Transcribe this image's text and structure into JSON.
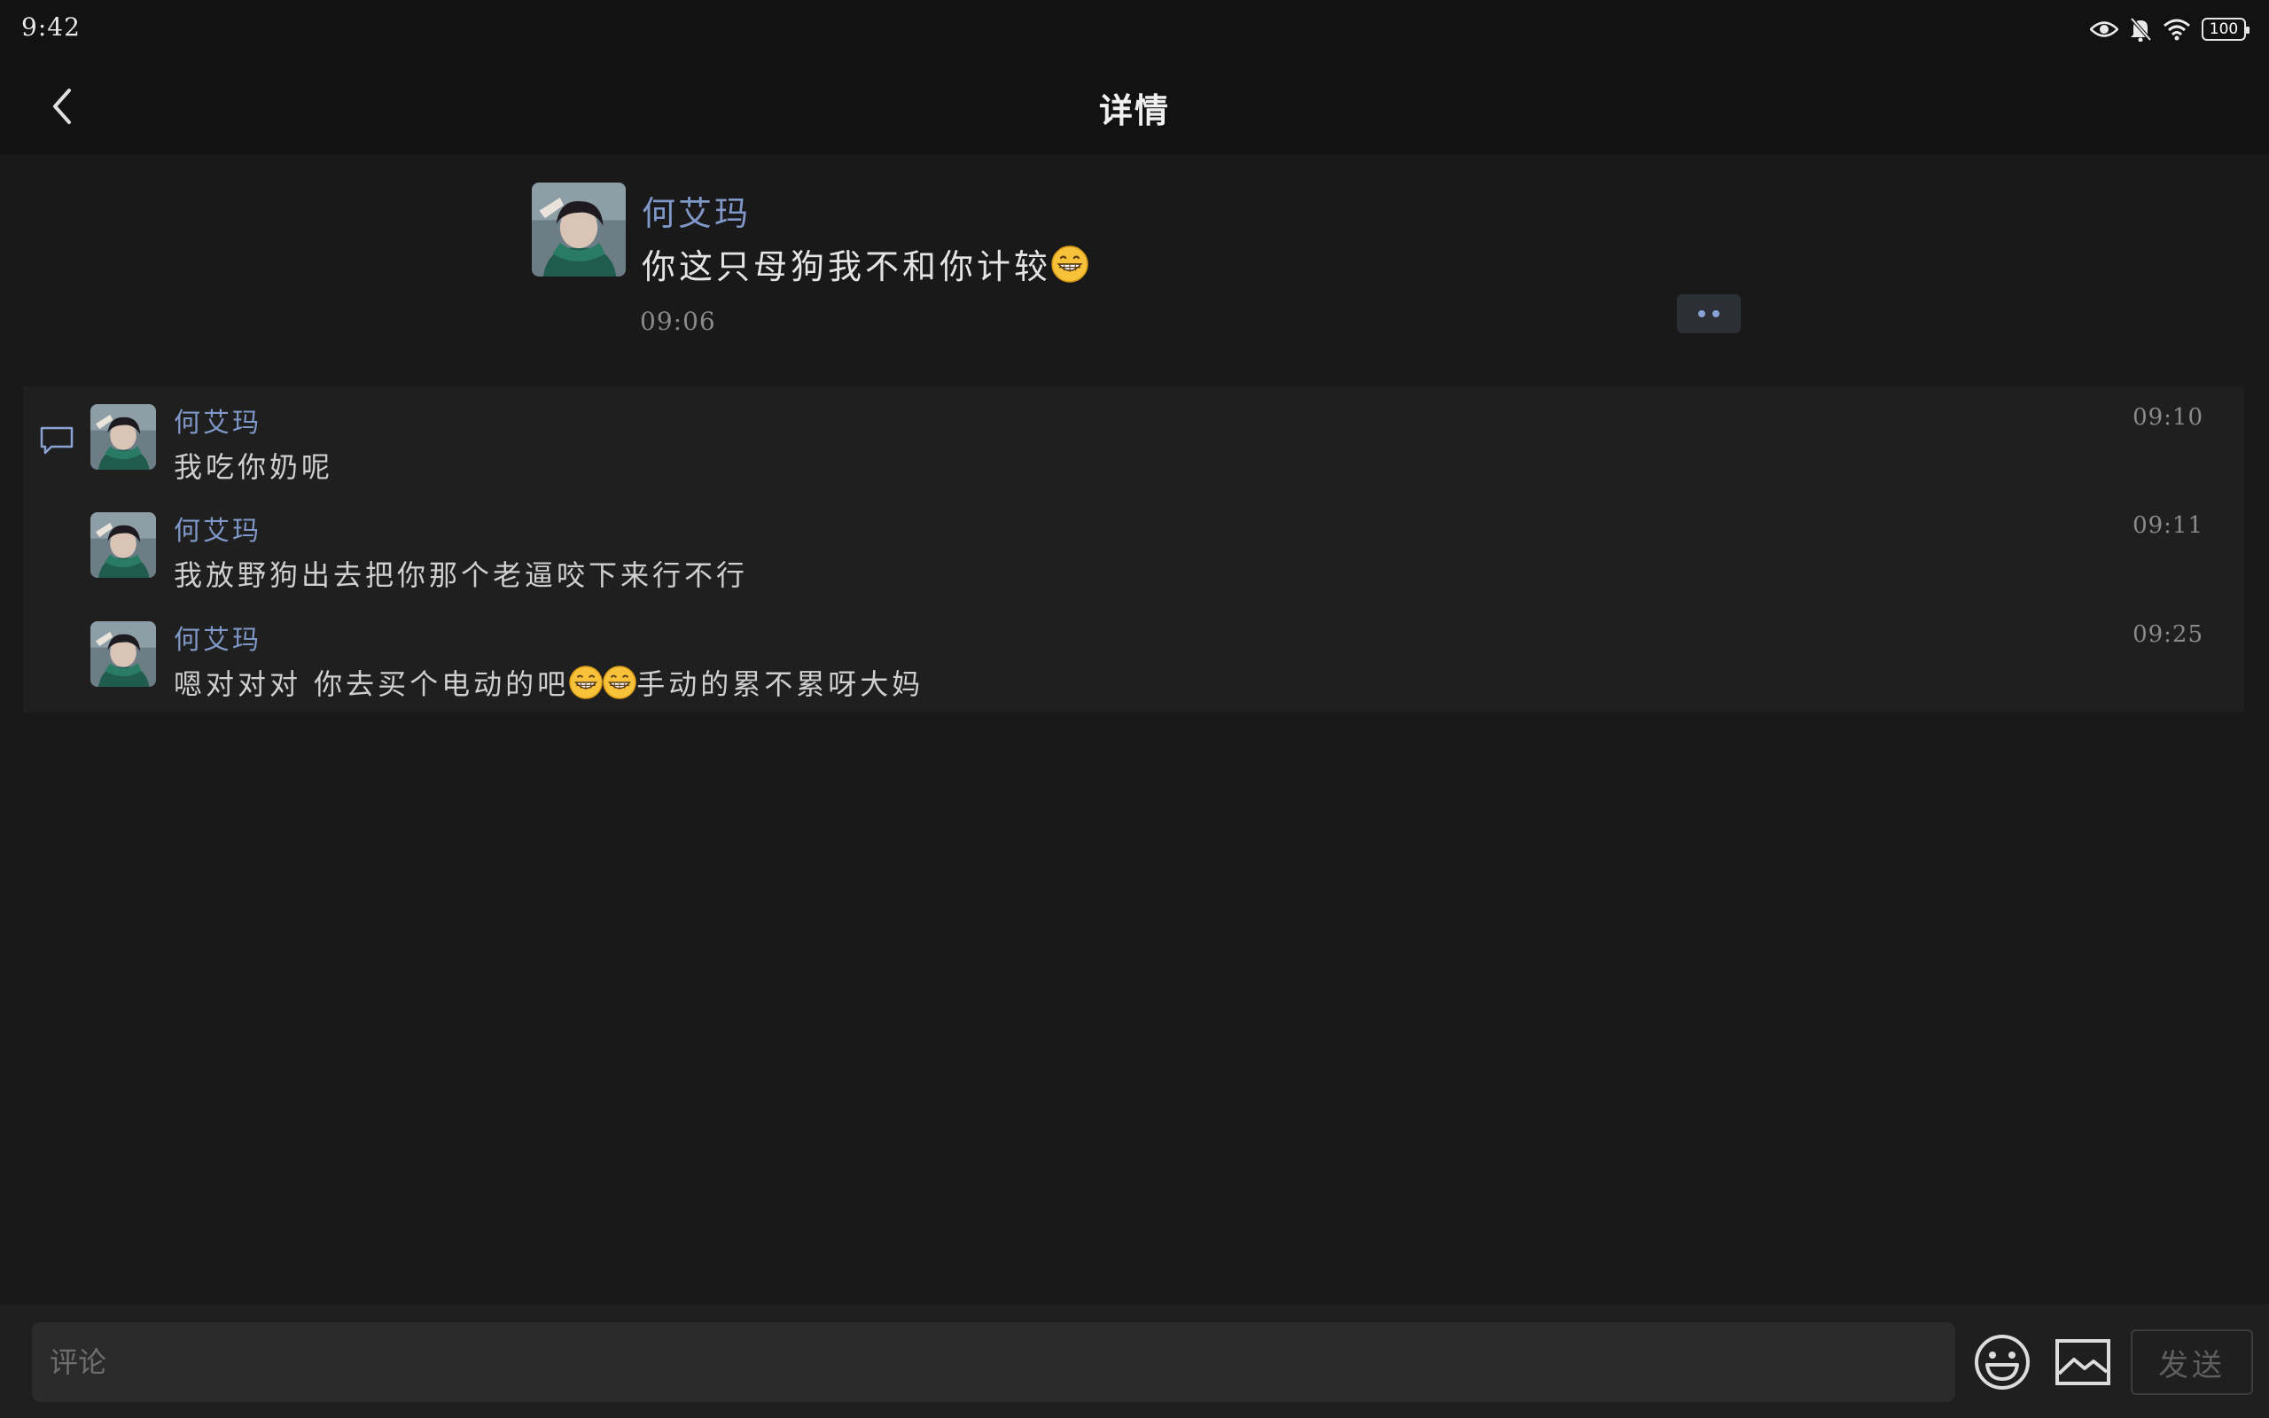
{
  "status_bar": {
    "time": "9:42",
    "battery": "100"
  },
  "nav": {
    "title": "详情",
    "back_icon": "chevron-left-icon"
  },
  "post": {
    "author": "何艾玛",
    "text": "你这只母狗我不和你计较",
    "emoji": "grinning-face-icon",
    "time": "09:06"
  },
  "comments": [
    {
      "author": "何艾玛",
      "text": "我吃你奶呢",
      "time": "09:10"
    },
    {
      "author": "何艾玛",
      "text": "我放野狗出去把你那个老逼咬下来行不行",
      "time": "09:11"
    },
    {
      "author": "何艾玛",
      "text_before": "嗯对对对 你去买个电动的吧",
      "text_after": "手动的累不累呀大妈",
      "emoji_count": 2,
      "time": "09:25"
    }
  ],
  "input": {
    "placeholder": "评论",
    "send_label": "发送"
  },
  "colors": {
    "background": "#191919",
    "name": "#7f98c8",
    "panel": "#1f1f1f"
  }
}
